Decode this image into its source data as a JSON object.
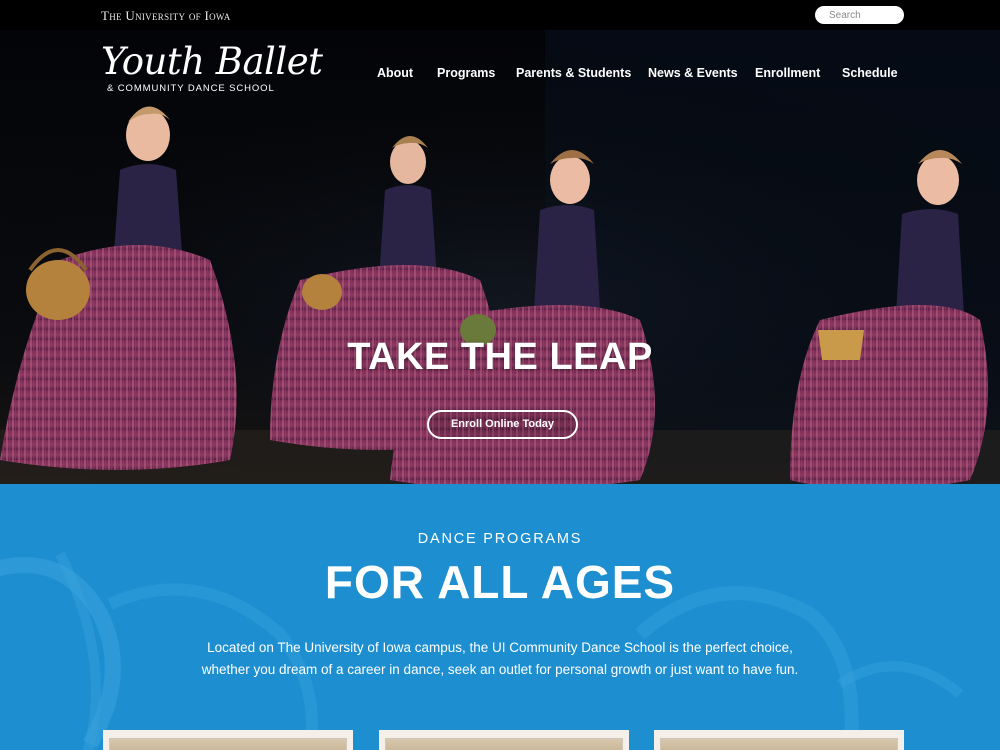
{
  "topbar": {
    "university": "The University of Iowa",
    "search_placeholder": "Search"
  },
  "logo": {
    "script": "Youth Ballet",
    "subtitle": "& COMMUNITY DANCE SCHOOL"
  },
  "nav": {
    "items": [
      "About",
      "Programs",
      "Parents & Students",
      "News & Events",
      "Enrollment",
      "Schedule"
    ]
  },
  "hero": {
    "title": "TAKE THE LEAP",
    "button_label": "Enroll Online Today"
  },
  "programs": {
    "kicker": "DANCE PROGRAMS",
    "title": "FOR ALL AGES",
    "description_line1": "Located on The University of Iowa campus, the UI Community Dance School is the perfect choice,",
    "description_line2": "whether you dream of a career in dance, seek an outlet for personal growth or just want to have fun."
  },
  "colors": {
    "accent_blue": "#1d8fd1",
    "hero_bg": "#07090d",
    "text_white": "#ffffff"
  }
}
